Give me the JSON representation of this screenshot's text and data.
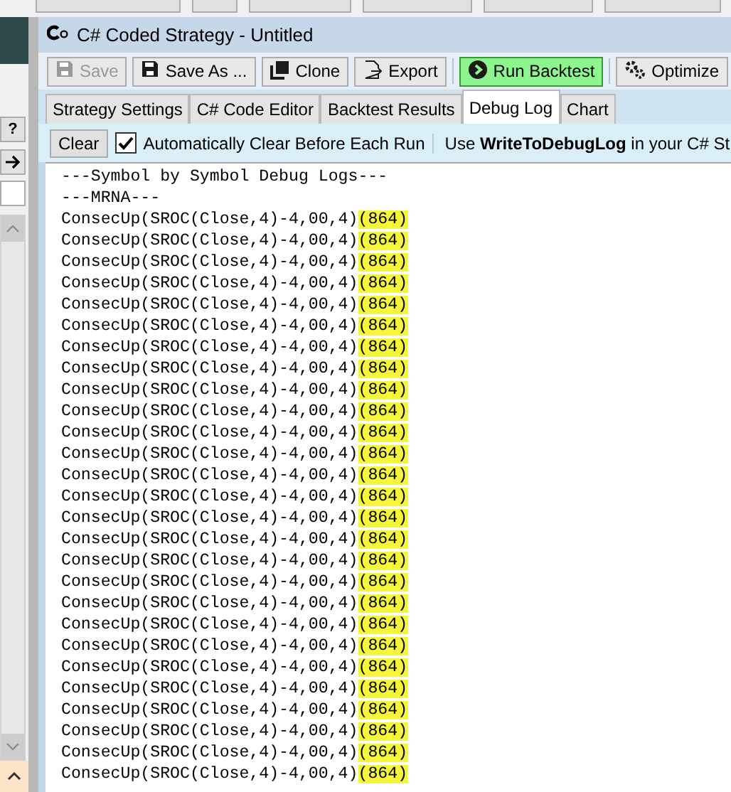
{
  "side_panel": {
    "help_button": "?"
  },
  "window": {
    "title": "C# Coded Strategy - Untitled"
  },
  "toolbar": [
    {
      "kind": "save",
      "label": "Save",
      "disabled": true
    },
    {
      "kind": "save",
      "label": "Save As ...",
      "disabled": false
    },
    {
      "kind": "clone",
      "label": "Clone",
      "disabled": false
    },
    {
      "kind": "export",
      "label": "Export",
      "disabled": false
    },
    {
      "kind": "run",
      "label": "Run Backtest",
      "disabled": false
    },
    {
      "kind": "optimize",
      "label": "Optimize",
      "disabled": false
    }
  ],
  "tabs": [
    {
      "label": "Strategy Settings",
      "selected": false
    },
    {
      "label": "C# Code Editor",
      "selected": false
    },
    {
      "label": "Backtest Results",
      "selected": false
    },
    {
      "label": "Debug Log",
      "selected": true
    },
    {
      "label": "Chart",
      "selected": false
    }
  ],
  "debug_bar": {
    "clear_button": "Clear",
    "auto_clear": {
      "label": "Automatically Clear Before Each Run",
      "checked": true
    },
    "hint": "Use **WriteToDebugLog** in your C# St"
  },
  "log": [
    {
      "text": "---Symbol by Symbol Debug Logs---"
    },
    {
      "text": "---MRNA---"
    },
    {
      "text": "ConsecUp(SROC(Close,4)-4,00,4)",
      "highlight": "(864)"
    },
    {
      "text": "ConsecUp(SROC(Close,4)-4,00,4)",
      "highlight": "(864)"
    },
    {
      "text": "ConsecUp(SROC(Close,4)-4,00,4)",
      "highlight": "(864)"
    },
    {
      "text": "ConsecUp(SROC(Close,4)-4,00,4)",
      "highlight": "(864)"
    },
    {
      "text": "ConsecUp(SROC(Close,4)-4,00,4)",
      "highlight": "(864)"
    },
    {
      "text": "ConsecUp(SROC(Close,4)-4,00,4)",
      "highlight": "(864)"
    },
    {
      "text": "ConsecUp(SROC(Close,4)-4,00,4)",
      "highlight": "(864)"
    },
    {
      "text": "ConsecUp(SROC(Close,4)-4,00,4)",
      "highlight": "(864)"
    },
    {
      "text": "ConsecUp(SROC(Close,4)-4,00,4)",
      "highlight": "(864)"
    },
    {
      "text": "ConsecUp(SROC(Close,4)-4,00,4)",
      "highlight": "(864)"
    },
    {
      "text": "ConsecUp(SROC(Close,4)-4,00,4)",
      "highlight": "(864)"
    },
    {
      "text": "ConsecUp(SROC(Close,4)-4,00,4)",
      "highlight": "(864)"
    },
    {
      "text": "ConsecUp(SROC(Close,4)-4,00,4)",
      "highlight": "(864)"
    },
    {
      "text": "ConsecUp(SROC(Close,4)-4,00,4)",
      "highlight": "(864)"
    },
    {
      "text": "ConsecUp(SROC(Close,4)-4,00,4)",
      "highlight": "(864)"
    },
    {
      "text": "ConsecUp(SROC(Close,4)-4,00,4)",
      "highlight": "(864)"
    },
    {
      "text": "ConsecUp(SROC(Close,4)-4,00,4)",
      "highlight": "(864)"
    },
    {
      "text": "ConsecUp(SROC(Close,4)-4,00,4)",
      "highlight": "(864)"
    },
    {
      "text": "ConsecUp(SROC(Close,4)-4,00,4)",
      "highlight": "(864)"
    },
    {
      "text": "ConsecUp(SROC(Close,4)-4,00,4)",
      "highlight": "(864)"
    },
    {
      "text": "ConsecUp(SROC(Close,4)-4,00,4)",
      "highlight": "(864)"
    },
    {
      "text": "ConsecUp(SROC(Close,4)-4,00,4)",
      "highlight": "(864)"
    },
    {
      "text": "ConsecUp(SROC(Close,4)-4,00,4)",
      "highlight": "(864)"
    },
    {
      "text": "ConsecUp(SROC(Close,4)-4,00,4)",
      "highlight": "(864)"
    },
    {
      "text": "ConsecUp(SROC(Close,4)-4,00,4)",
      "highlight": "(864)"
    },
    {
      "text": "ConsecUp(SROC(Close,4)-4,00,4)",
      "highlight": "(864)"
    },
    {
      "text": "ConsecUp(SROC(Close,4)-4,00,4)",
      "highlight": "(864)"
    }
  ]
}
